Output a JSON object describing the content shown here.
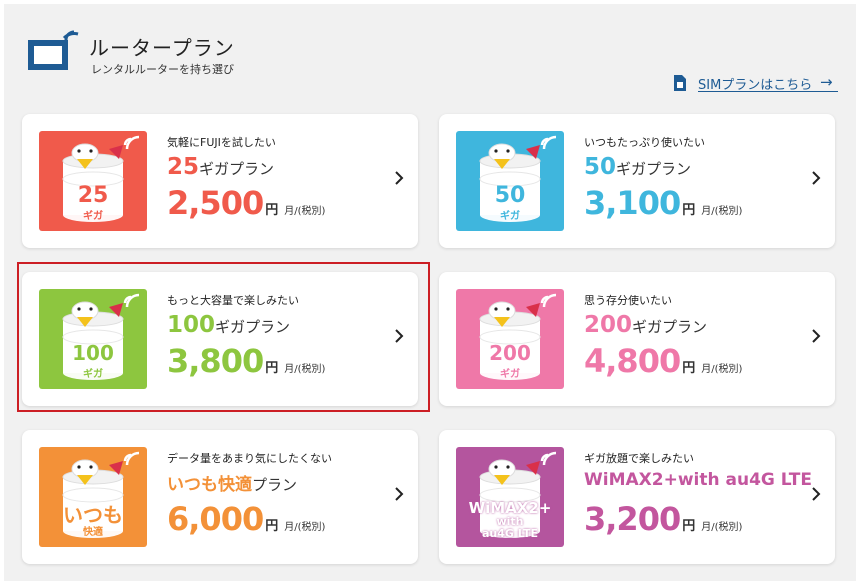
{
  "header": {
    "title": "ルータープラン",
    "subtitle": "レンタルルーターを持ち選び",
    "icon": "router-icon"
  },
  "sim_link": {
    "label": "SIMプランはこちら",
    "arrow": "→",
    "color": "#1e5b94"
  },
  "plans": [
    {
      "tagline": "気軽にFUJIを試したい",
      "plan_number": "25",
      "plan_suffix": "ギガプラン",
      "price": "2,500",
      "yen": "円",
      "per": "月/(税別)",
      "badge_line1": "25",
      "badge_line2": "ギガ",
      "color": "#f05a4b",
      "bg": "#f05a4b"
    },
    {
      "tagline": "いつもたっぷり使いたい",
      "plan_number": "50",
      "plan_suffix": "ギガプラン",
      "price": "3,100",
      "yen": "円",
      "per": "月/(税別)",
      "badge_line1": "50",
      "badge_line2": "ギガ",
      "color": "#3fb6dd",
      "bg": "#3fb6dd"
    },
    {
      "tagline": "もっと大容量で楽しみたい",
      "plan_number": "100",
      "plan_suffix": "ギガプラン",
      "price": "3,800",
      "yen": "円",
      "per": "月/(税別)",
      "badge_line1": "100",
      "badge_line2": "ギガ",
      "color": "#8dc63f",
      "bg": "#8dc63f"
    },
    {
      "tagline": "思う存分使いたい",
      "plan_number": "200",
      "plan_suffix": "ギガプラン",
      "price": "4,800",
      "yen": "円",
      "per": "月/(税別)",
      "badge_line1": "200",
      "badge_line2": "ギガ",
      "color": "#ef78a8",
      "bg": "#ef78a8"
    },
    {
      "tagline": "データ量をあまり気にしたくない",
      "plan_number": "いつも快適",
      "plan_suffix": "プラン",
      "price": "6,000",
      "yen": "円",
      "per": "月/(税別)",
      "badge_line1": "いつも",
      "badge_line2": "快適",
      "color": "#f39138",
      "bg": "#f39138"
    },
    {
      "tagline": "ギガ放題で楽しみたい",
      "plan_number": "WiMAX2+with au4G LTE",
      "plan_suffix": "",
      "price": "3,200",
      "yen": "円",
      "per": "月/(税別)",
      "badge_line1": "WiMAX2+",
      "badge_line2": "with",
      "badge_line3": "au4G LTE",
      "color": "#c3569e",
      "bg": "#b4559e"
    }
  ],
  "highlighted_plan": "100"
}
